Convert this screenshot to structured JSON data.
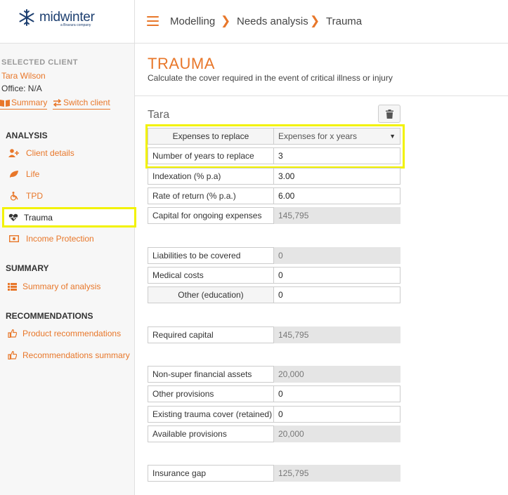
{
  "brand": {
    "name": "midwinter",
    "sub": "a Bravura company"
  },
  "client": {
    "section_label": "SELECTED CLIENT",
    "name": "Tara Wilson",
    "office": "Office: N/A",
    "summary_link": "Summary",
    "switch_link": "Switch client"
  },
  "nav": {
    "analysis_head": "ANALYSIS",
    "analysis": [
      {
        "label": "Client details",
        "icon": "add-user-icon"
      },
      {
        "label": "Life",
        "icon": "leaf-icon"
      },
      {
        "label": "TPD",
        "icon": "wheelchair-icon"
      },
      {
        "label": "Trauma",
        "icon": "heartbeat-icon",
        "active": true
      },
      {
        "label": "Income Protection",
        "icon": "money-icon"
      }
    ],
    "summary_head": "SUMMARY",
    "summary": [
      {
        "label": "Summary of analysis",
        "icon": "list-icon"
      }
    ],
    "recommendations_head": "RECOMMENDATIONS",
    "recommendations": [
      {
        "label": "Product recommendations",
        "icon": "thumbs-up-icon"
      },
      {
        "label": "Recommendations summary",
        "icon": "thumbs-up-icon"
      }
    ]
  },
  "breadcrumb": [
    "Modelling",
    "Needs analysis",
    "Trauma"
  ],
  "page": {
    "title": "TRAUMA",
    "subtitle": "Calculate the cover required in the event of critical illness or injury",
    "person": "Tara"
  },
  "form": {
    "expenses_label": "Expenses to replace",
    "expenses_value": "Expenses for x years",
    "years_label": "Number of years to replace",
    "years_value": "3",
    "indexation_label": "Indexation (% p.a)",
    "indexation_value": "3.00",
    "return_label": "Rate of return (% p.a.)",
    "return_value": "6.00",
    "capital_label": "Capital for ongoing expenses",
    "capital_value": "145,795",
    "liabilities_label": "Liabilities to be covered",
    "liabilities_value": "0",
    "medical_label": "Medical costs",
    "medical_value": "0",
    "other_label": "Other (education)",
    "other_value": "0",
    "required_label": "Required capital",
    "required_value": "145,795",
    "nonsuper_label": "Non-super financial assets",
    "nonsuper_value": "20,000",
    "provisions_label": "Other provisions",
    "provisions_value": "0",
    "existing_label": "Existing trauma cover (retained)",
    "existing_value": "0",
    "available_label": "Available provisions",
    "available_value": "20,000",
    "gap_label": "Insurance gap",
    "gap_value": "125,795"
  },
  "colors": {
    "accent": "#e8772a",
    "highlight": "#f2f200",
    "brand": "#1d3f70"
  }
}
